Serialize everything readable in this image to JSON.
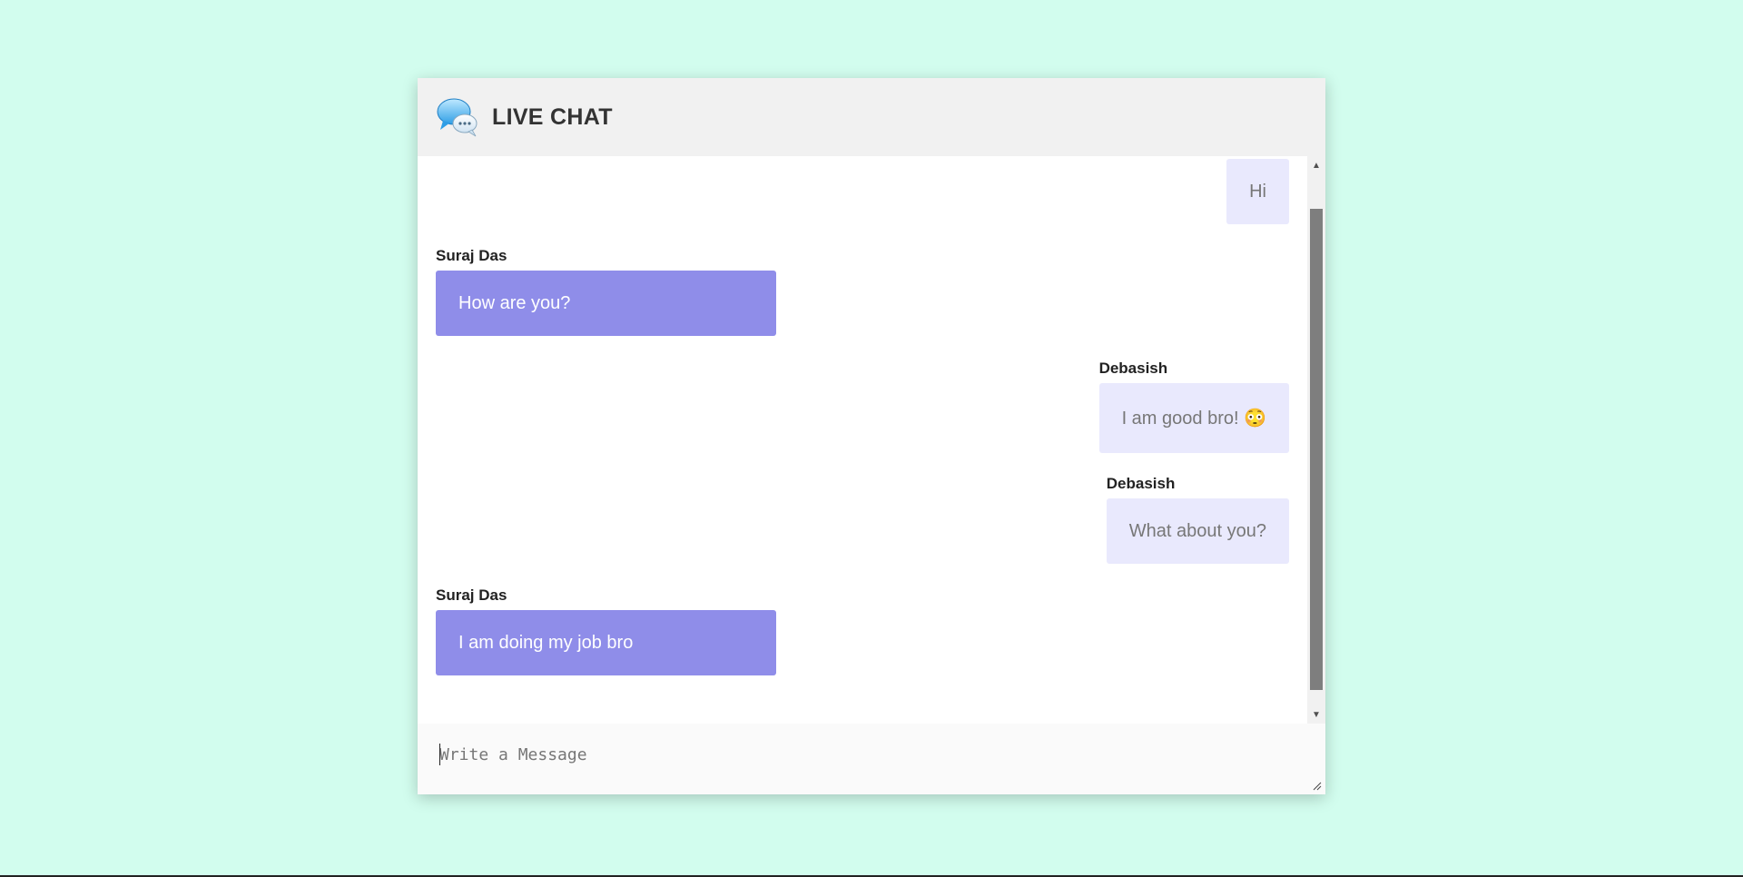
{
  "header": {
    "title": "LIVE CHAT",
    "logo_icon": "chat-bubbles-icon"
  },
  "messages": [
    {
      "direction": "outgoing",
      "sender": "",
      "text": "Hi"
    },
    {
      "direction": "incoming",
      "sender": "Suraj Das",
      "text": "How are you?"
    },
    {
      "direction": "outgoing",
      "sender": "Debasish",
      "text": "I am good bro! 😳"
    },
    {
      "direction": "outgoing",
      "sender": "Debasish",
      "text": "What about you?"
    },
    {
      "direction": "incoming",
      "sender": "Suraj Das",
      "text": "I am doing my job bro"
    }
  ],
  "composer": {
    "placeholder": "Write a Message",
    "value": ""
  },
  "colors": {
    "page_background": "#d2fdee",
    "incoming_bubble": "#8f8de9",
    "outgoing_bubble": "#e9e9fd",
    "header_background": "#f1f1f1"
  }
}
